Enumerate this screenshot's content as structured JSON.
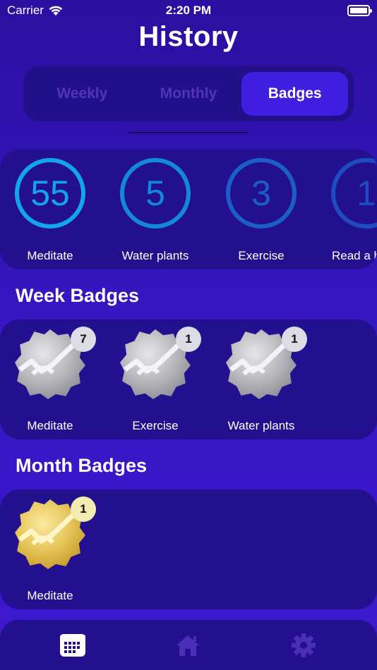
{
  "status_bar": {
    "carrier": "Carrier",
    "time": "2:20 PM"
  },
  "title": "History",
  "segments": [
    {
      "label": "Weekly",
      "active": false
    },
    {
      "label": "Monthly",
      "active": false
    },
    {
      "label": "Badges",
      "active": true
    }
  ],
  "counters": [
    {
      "value": "55",
      "label": "Meditate",
      "color": "#12a4ee"
    },
    {
      "value": "5",
      "label": "Water plants",
      "color": "#1288dd"
    },
    {
      "value": "3",
      "label": "Exercise",
      "color": "#1a5ec8"
    },
    {
      "value": "1",
      "label": "Read a book",
      "color": "#1d4cc0"
    }
  ],
  "week_badges": {
    "title": "Week Badges",
    "items": [
      {
        "label": "Meditate",
        "count": "7"
      },
      {
        "label": "Exercise",
        "count": "1"
      },
      {
        "label": "Water plants",
        "count": "1"
      }
    ]
  },
  "month_badges": {
    "title": "Month Badges",
    "items": [
      {
        "label": "Meditate",
        "count": "1"
      }
    ]
  },
  "tab_bar": {
    "items": [
      {
        "icon": "calendar-icon",
        "active": true
      },
      {
        "icon": "home-icon",
        "active": false
      },
      {
        "icon": "gear-icon",
        "active": false
      }
    ]
  },
  "colors": {
    "background": "#3516c0",
    "card": "#23108f",
    "active_segment": "#3f1ee0",
    "inactive_text": "#5134b8",
    "silver_badge": "#b8b8c0",
    "gold_badge": "#e8c85a"
  }
}
